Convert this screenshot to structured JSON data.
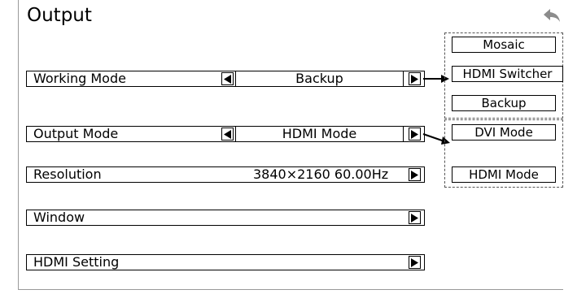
{
  "header": {
    "title": "Output",
    "back_icon": "back-arrow-icon"
  },
  "rows": [
    {
      "label": "Working Mode",
      "value": "Backup"
    },
    {
      "label": "Output Mode",
      "value": "HDMI Mode"
    },
    {
      "label": "Resolution",
      "value": "3840×2160 60.00Hz"
    },
    {
      "label": "Window"
    },
    {
      "label": "HDMI Setting"
    }
  ],
  "working_mode_options": [
    "Mosaic",
    "HDMI Switcher",
    "Backup"
  ],
  "output_mode_options": [
    "DVI Mode",
    "HDMI Mode"
  ],
  "icons": {
    "left": "triangle-left-icon",
    "right": "triangle-right-icon"
  }
}
